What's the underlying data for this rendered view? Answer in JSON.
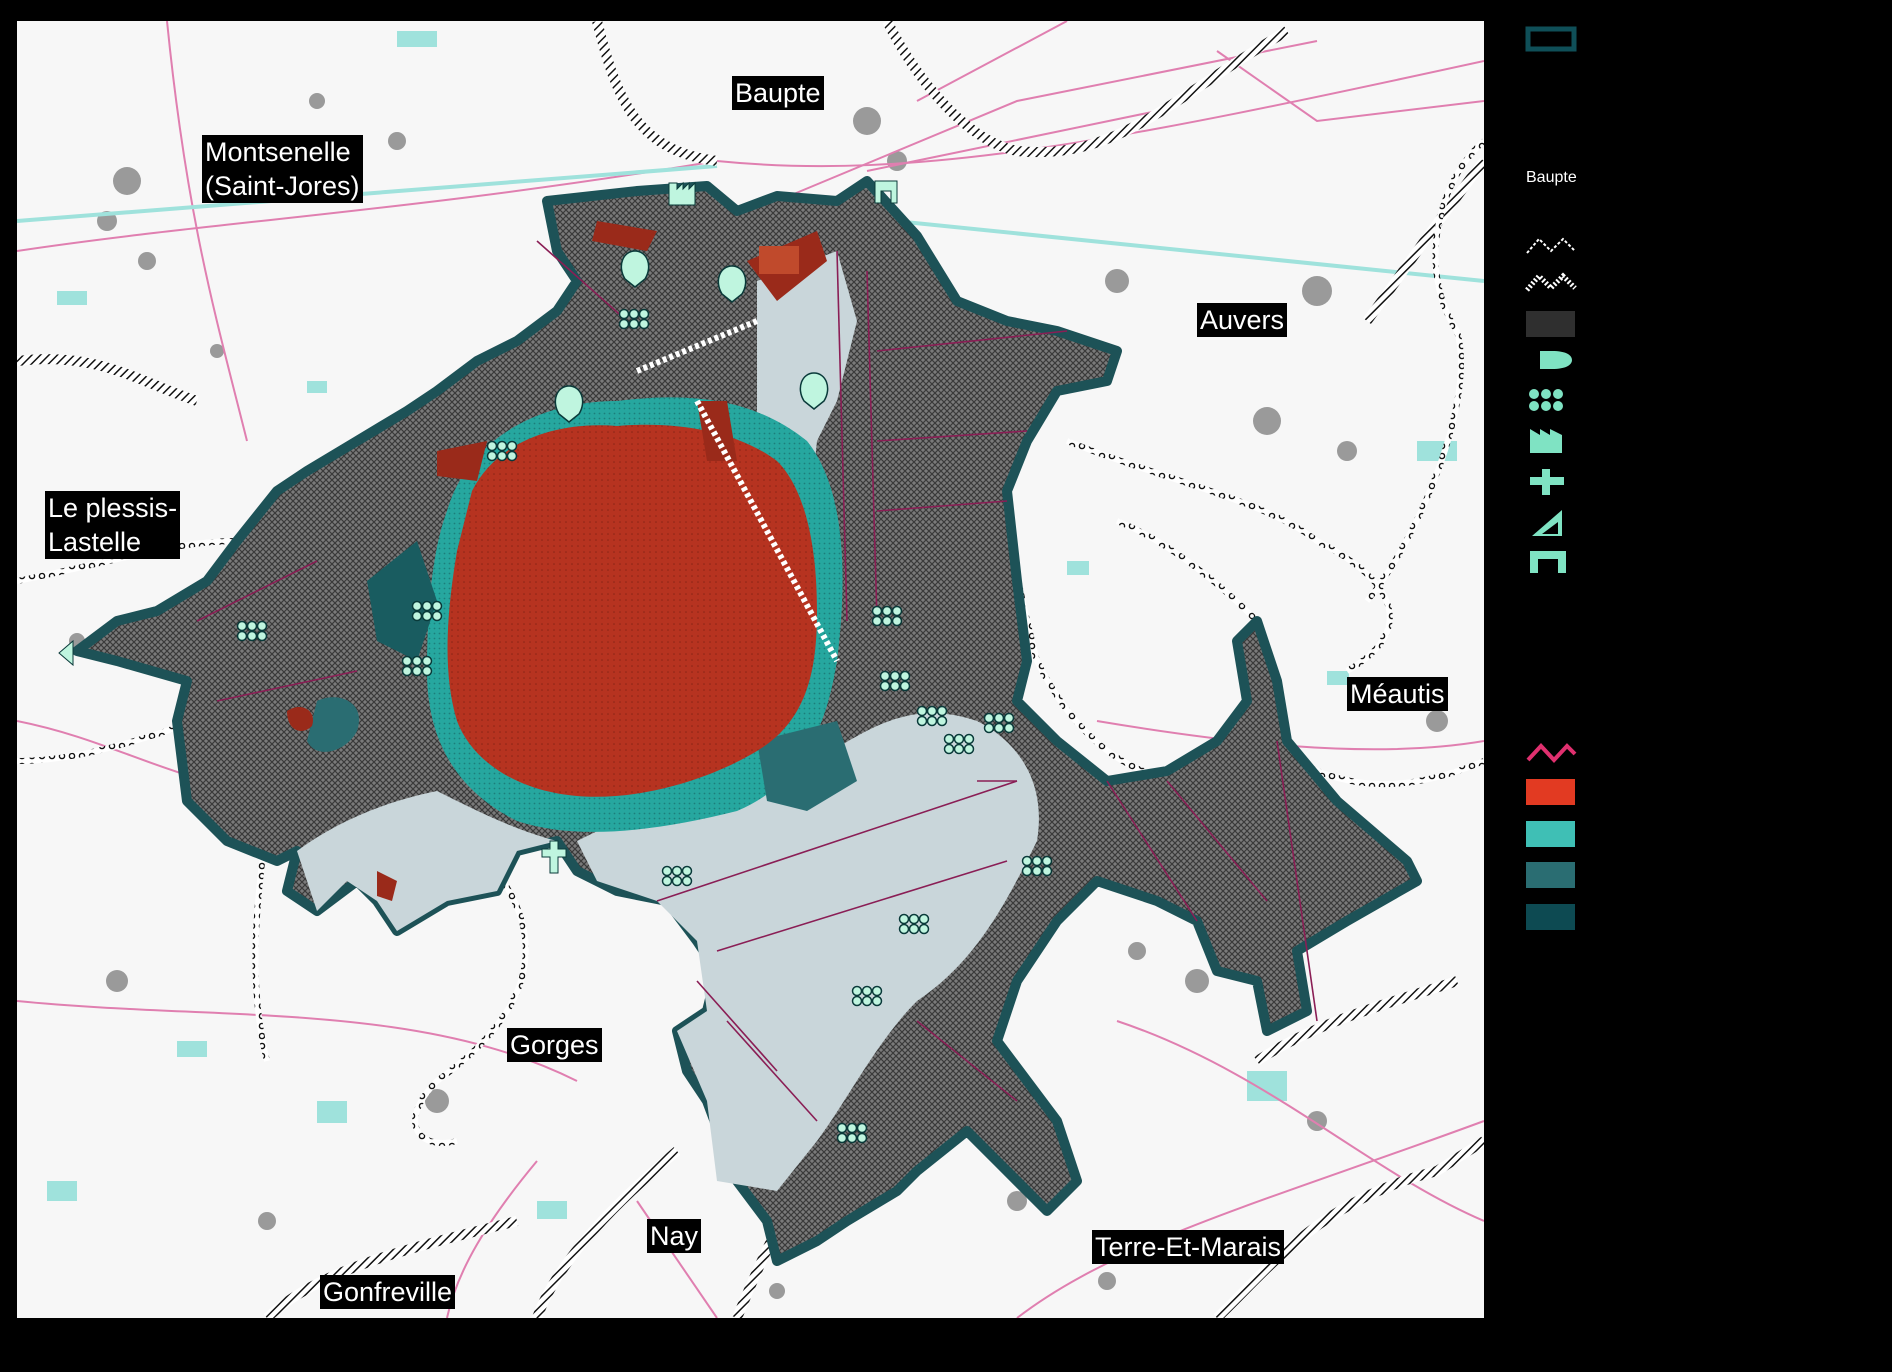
{
  "places": {
    "baupte": "Baupte",
    "montsenelle": "Montsenelle\n(Saint-Jores)",
    "auvers": "Auvers",
    "le_plessis": "Le plessis-\nLastelle",
    "meautis": "Méautis",
    "gorges": "Gorges",
    "nay": "Nay",
    "terre_et_marais": "Terre-Et-Marais",
    "gonfreville": "Gonfreville"
  },
  "legend": {
    "items": [
      {
        "key": "perimeter",
        "icon": "outline-rectangle-icon",
        "color": "#0f4f58"
      },
      {
        "key": "commune",
        "label": "Baupte"
      },
      {
        "key": "path",
        "icon": "dashed-path-line-icon",
        "color": "#ffffff"
      },
      {
        "key": "path-hatched",
        "icon": "hatched-path-line-icon",
        "color": "#ffffff"
      },
      {
        "key": "buildings",
        "icon": "dark-grey-swatch-icon",
        "color": "#2f2f2f"
      },
      {
        "key": "hide",
        "icon": "observation-hide-icon",
        "color": "#7fe3c3"
      },
      {
        "key": "trees",
        "icon": "tree-cluster-icon",
        "color": "#7fe3c3"
      },
      {
        "key": "factory",
        "icon": "factory-icon",
        "color": "#7fe3c3"
      },
      {
        "key": "cross",
        "icon": "cross-icon",
        "color": "#7fe3c3"
      },
      {
        "key": "camp",
        "icon": "tent-icon",
        "color": "#7fe3c3"
      },
      {
        "key": "gate",
        "icon": "gate-icon",
        "color": "#7fe3c3"
      },
      {
        "key": "hydro",
        "icon": "pink-wave-line-icon",
        "color": "#e0306f"
      },
      {
        "key": "peat",
        "icon": "red-swatch-icon",
        "color": "#e23a22"
      },
      {
        "key": "water-light",
        "icon": "turquoise-swatch-icon",
        "color": "#3fbfb5"
      },
      {
        "key": "water-mid",
        "icon": "teal-swatch-icon",
        "color": "#2a6d72"
      },
      {
        "key": "water-dark",
        "icon": "dark-teal-swatch-icon",
        "color": "#0d4a52"
      }
    ]
  },
  "colors": {
    "background": "#000000",
    "map_base": "#f7f7f7",
    "marsh_grey": "#6c6c6c",
    "meadow_pale": "#c9d6da",
    "peat_red": "#b63320",
    "water_teal": "#2cb0a8",
    "outline": "#1d5257",
    "roads_pink": "#e07fb0",
    "ditch_cyan": "#8ee0dc"
  }
}
